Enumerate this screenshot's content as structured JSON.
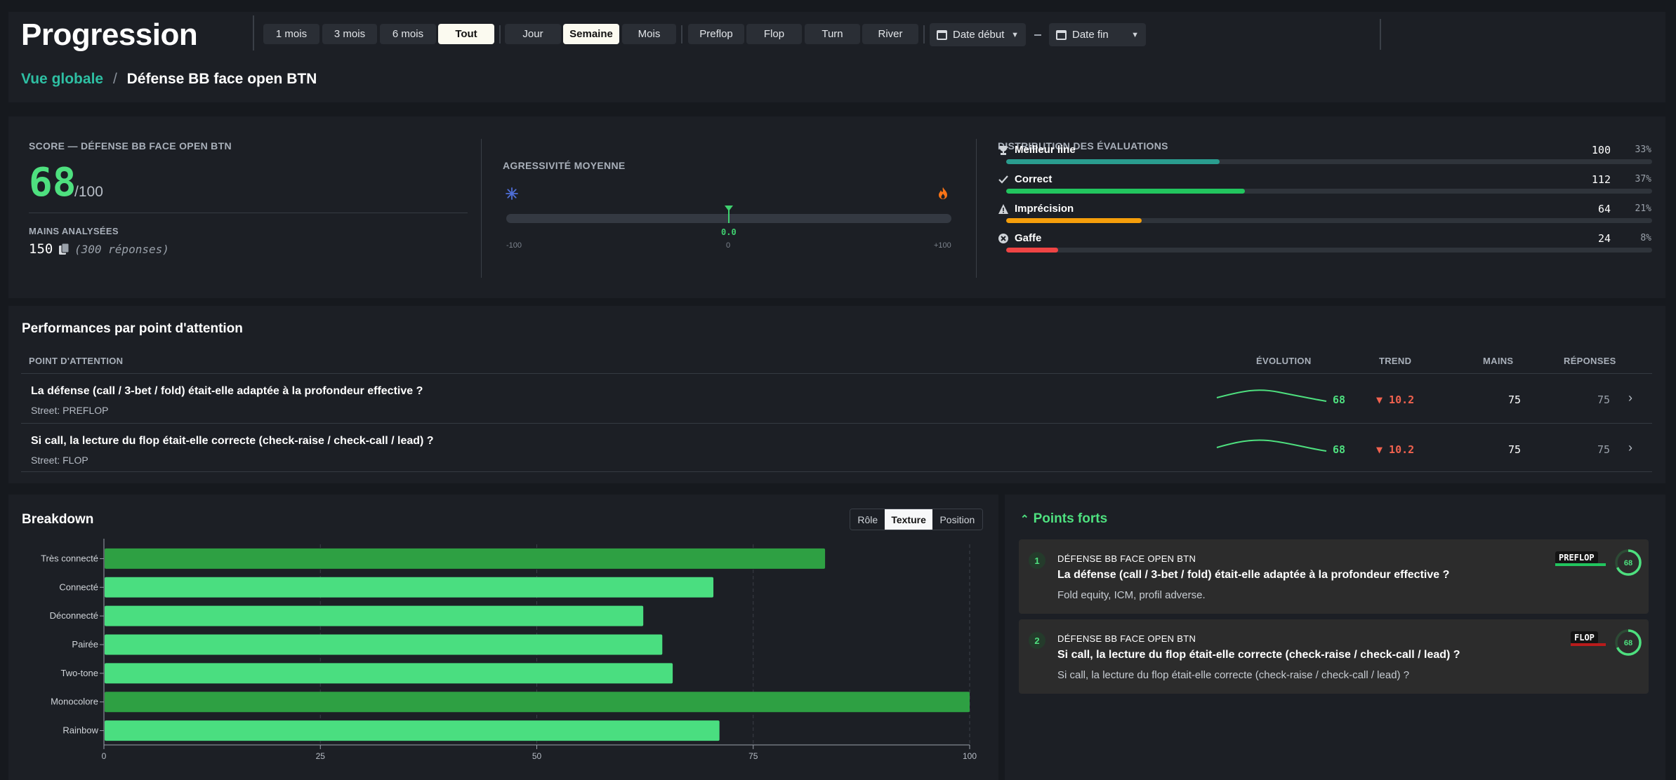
{
  "header": {
    "title": "Progression",
    "periods": [
      "1 mois",
      "3 mois",
      "6 mois",
      "Tout"
    ],
    "granularity": [
      "Jour",
      "Semaine",
      "Mois"
    ],
    "streets": [
      "Preflop",
      "Flop",
      "Turn",
      "River"
    ],
    "date_start": "Date début",
    "date_end": "Date fin"
  },
  "breadcrumb": {
    "root": "Vue globale",
    "sep": "/",
    "current": "Défense BB face open BTN"
  },
  "score": {
    "label": "SCORE — DÉFENSE BB FACE OPEN BTN",
    "value": "68",
    "max": "/100",
    "hands_label": "MAINS ANALYSÉES",
    "hands": "150",
    "responses": "(300 réponses)"
  },
  "aggressivity": {
    "label": "AGRESSIVITÉ MOYENNE",
    "value": "0.0",
    "value_num": 0,
    "min_label": "-100",
    "mid_label": "0",
    "max_label": "+100"
  },
  "distribution": {
    "label": "DISTRIBUTION DES ÉVALUATIONS",
    "items": [
      {
        "name": "Meilleur line",
        "count": "100",
        "pct": "33%",
        "fraction": 0.33,
        "color": "#2a9d8f",
        "icon": "trophy-icon"
      },
      {
        "name": "Correct",
        "count": "112",
        "pct": "37%",
        "fraction": 0.37,
        "color": "#22c55e",
        "icon": "check-icon"
      },
      {
        "name": "Imprécision",
        "count": "64",
        "pct": "21%",
        "fraction": 0.21,
        "color": "#f59e0b",
        "icon": "warning-icon"
      },
      {
        "name": "Gaffe",
        "count": "24",
        "pct": "8%",
        "fraction": 0.08,
        "color": "#ef4444",
        "icon": "x-circle-icon"
      }
    ]
  },
  "performance": {
    "title": "Performances par point d'attention",
    "columns": {
      "point": "POINT D'ATTENTION",
      "evolution": "ÉVOLUTION",
      "trend": "TREND",
      "mains": "MAINS",
      "responses": "RÉPONSES"
    },
    "rows": [
      {
        "question": "La défense (call / 3-bet / fold) était-elle adaptée à la profondeur effective ?",
        "street": "Street: PREFLOP",
        "score": "68",
        "trend": "▼ 10.2",
        "mains": "75",
        "responses": "75"
      },
      {
        "question": "Si call, la lecture du flop était-elle correcte (check-raise / check-call / lead) ?",
        "street": "Street: FLOP",
        "score": "68",
        "trend": "▼ 10.2",
        "mains": "75",
        "responses": "75"
      }
    ]
  },
  "breakdown": {
    "title": "Breakdown",
    "tabs": [
      "Rôle",
      "Texture",
      "Position"
    ],
    "active_tab": "Texture"
  },
  "chart_data": {
    "type": "bar",
    "orientation": "horizontal",
    "categories": [
      "Très connecté",
      "Connecté",
      "Déconnecté",
      "Pairée",
      "Two-tone",
      "Monocolore",
      "Rainbow"
    ],
    "values": [
      83.3,
      70.4,
      62.3,
      64.5,
      65.7,
      100,
      71.1
    ],
    "colors": [
      "#2ea043",
      "#4ade80",
      "#4ade80",
      "#4ade80",
      "#4ade80",
      "#2ea043",
      "#4ade80"
    ],
    "xlim": [
      0,
      100
    ],
    "xticks": [
      "0",
      "25",
      "50",
      "75",
      "100"
    ],
    "grid": true,
    "title": "",
    "xlabel": "",
    "ylabel": ""
  },
  "strengths": {
    "title": "Points forts",
    "items": [
      {
        "num": "1",
        "context": "DÉFENSE BB FACE OPEN BTN",
        "question": "La défense (call / 3-bet / fold) était-elle adaptée à la profondeur effective ?",
        "desc": "Fold equity, ICM, profil adverse.",
        "tag": "PREFLOP",
        "tag_color": "#22c55e",
        "score": "68",
        "score_num": 68
      },
      {
        "num": "2",
        "context": "DÉFENSE BB FACE OPEN BTN",
        "question": "Si call, la lecture du flop était-elle correcte (check-raise / check-call / lead) ?",
        "desc": "Si call, la lecture du flop était-elle correcte (check-raise / check-call / lead) ?",
        "tag": "FLOP",
        "tag_color": "#b91c1c",
        "score": "68",
        "score_num": 68
      }
    ]
  }
}
